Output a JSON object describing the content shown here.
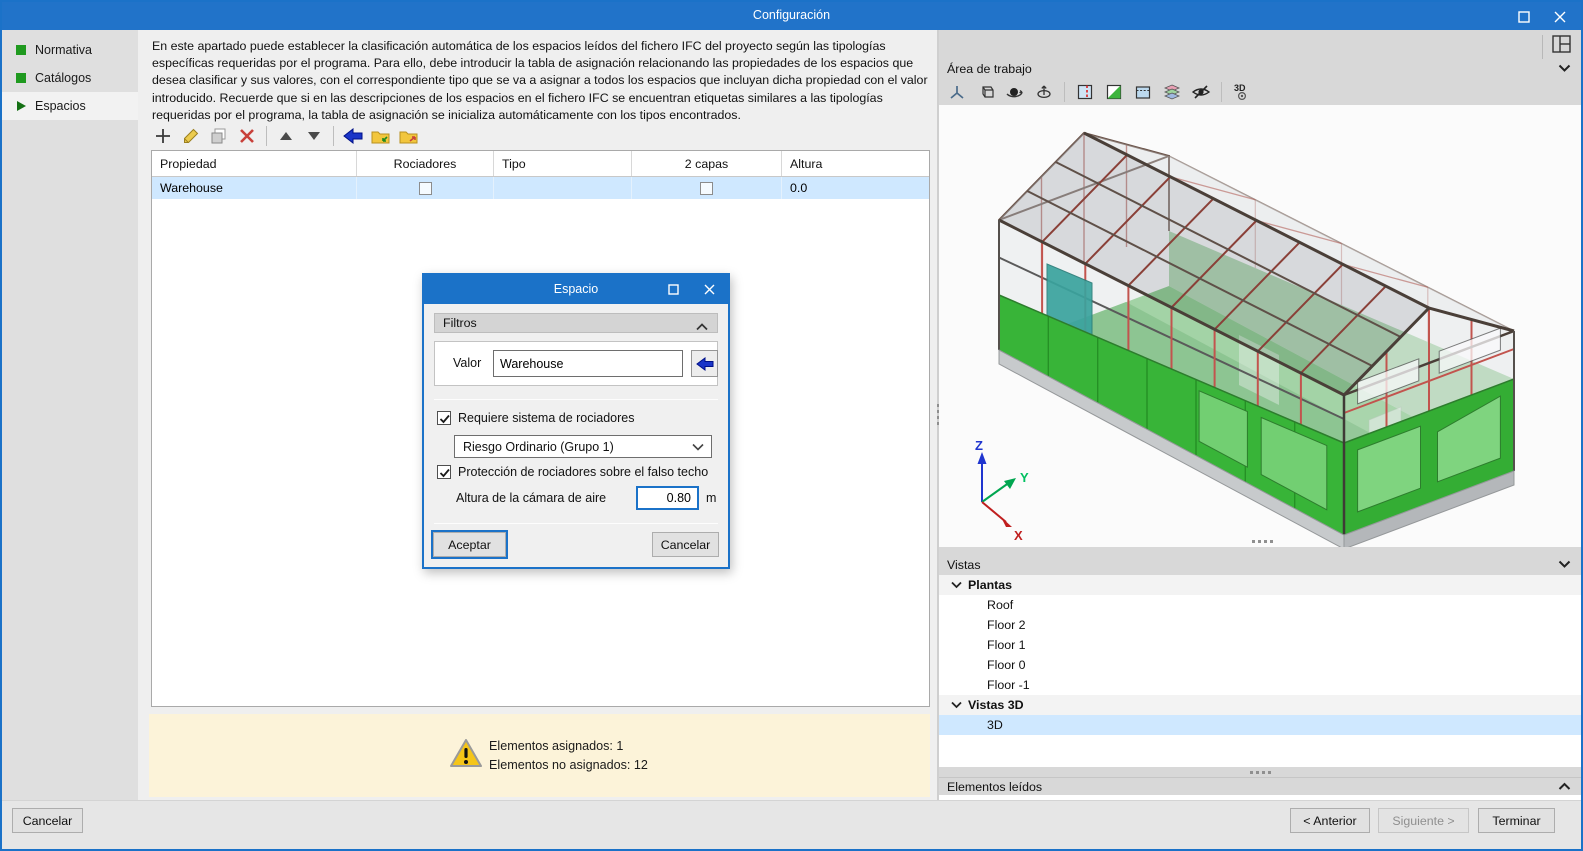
{
  "window": {
    "title": "Configuración"
  },
  "sidebar": {
    "items": [
      {
        "label": "Normativa"
      },
      {
        "label": "Catálogos"
      },
      {
        "label": "Espacios"
      }
    ]
  },
  "main": {
    "description": "En este apartado puede establecer la clasificación automática de los espacios leídos del fichero IFC del proyecto según las tipologías específicas requeridas por el programa. Para ello, debe introducir la tabla de asignación relacionando las propiedades de los espacios que desea clasificar y sus valores, con el correspondiente tipo que se va a asignar a todos los espacios que incluyan dicha propiedad con el valor introducido. Recuerde que si en las descripciones de los espacios en el fichero IFC se encuentran etiquetas similares a las tipologías requeridas por el programa, la tabla de asignación se inicializa automáticamente con los tipos encontrados.",
    "table": {
      "headers": [
        "Propiedad",
        "Rociadores",
        "Tipo",
        "2 capas",
        "Altura"
      ],
      "rows": [
        {
          "propiedad": "Warehouse",
          "rociadores_checked": false,
          "tipo": "",
          "capas_checked": false,
          "altura": "0.0"
        }
      ]
    },
    "warning": {
      "assigned": "Elementos asignados: 1",
      "unassigned": "Elementos no asignados: 12"
    }
  },
  "dialog": {
    "title": "Espacio",
    "filtros_label": "Filtros",
    "valor_label": "Valor",
    "valor_value": "Warehouse",
    "requires_sprinklers_label": "Requiere sistema de rociadores",
    "risk_value": "Riesgo Ordinario (Grupo 1)",
    "ceiling_label": "Protección de rociadores sobre el falso techo",
    "air_gap_label": "Altura de la cámara de aire",
    "air_gap_value": "0.80",
    "air_gap_unit": "m",
    "accept_label": "Aceptar",
    "cancel_label": "Cancelar"
  },
  "right_panel": {
    "workspace_title": "Área de trabajo",
    "views_title": "Vistas",
    "tree": {
      "plantas_label": "Plantas",
      "plantas": [
        "Roof",
        "Floor 2",
        "Floor 1",
        "Floor 0",
        "Floor -1"
      ],
      "vistas3d_label": "Vistas 3D",
      "vistas3d": [
        "3D"
      ]
    },
    "elements_title": "Elementos leídos",
    "axis": {
      "x": "X",
      "y": "Y",
      "z": "Z"
    }
  },
  "footer": {
    "cancel": "Cancelar",
    "previous": "< Anterior",
    "next": "Siguiente >",
    "finish": "Terminar"
  },
  "colors": {
    "accent": "#1b72c8",
    "selection": "#cfe8ff",
    "warning_bg": "#fcf3d9",
    "building_green": "#38b438",
    "frame_red": "#c2544e",
    "frame_dark": "#5a4a42",
    "teal_door": "#3aa39e"
  }
}
